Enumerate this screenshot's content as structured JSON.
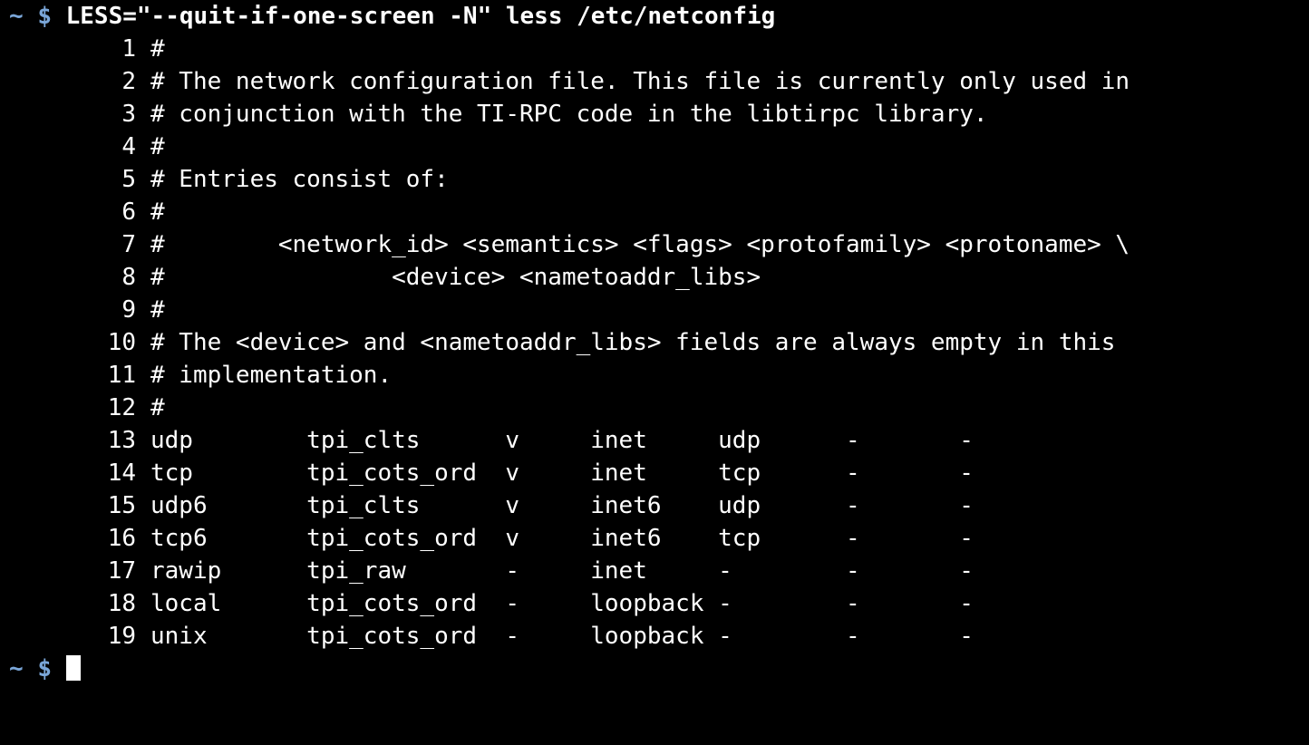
{
  "terminal": {
    "background_color": "#000000",
    "foreground_color": "#ffffff",
    "prompt_color": "#7aa6d8",
    "cursor_color": "#ffffff",
    "prompt_cwd": "~",
    "prompt_symbol": "$",
    "command": "LESS=\"--quit-if-one-screen -N\" less /etc/netconfig",
    "pager_lines": [
      {
        "n": "1",
        "text": "#"
      },
      {
        "n": "2",
        "text": "# The network configuration file. This file is currently only used in"
      },
      {
        "n": "3",
        "text": "# conjunction with the TI-RPC code in the libtirpc library."
      },
      {
        "n": "4",
        "text": "#"
      },
      {
        "n": "5",
        "text": "# Entries consist of:"
      },
      {
        "n": "6",
        "text": "#"
      },
      {
        "n": "7",
        "text": "#        <network_id> <semantics> <flags> <protofamily> <protoname> \\"
      },
      {
        "n": "8",
        "text": "#                <device> <nametoaddr_libs>"
      },
      {
        "n": "9",
        "text": "#"
      },
      {
        "n": "10",
        "text": "# The <device> and <nametoaddr_libs> fields are always empty in this"
      },
      {
        "n": "11",
        "text": "# implementation."
      },
      {
        "n": "12",
        "text": "#"
      },
      {
        "n": "13",
        "text": "udp        tpi_clts      v     inet     udp      -       -"
      },
      {
        "n": "14",
        "text": "tcp        tpi_cots_ord  v     inet     tcp      -       -"
      },
      {
        "n": "15",
        "text": "udp6       tpi_clts      v     inet6    udp      -       -"
      },
      {
        "n": "16",
        "text": "tcp6       tpi_cots_ord  v     inet6    tcp      -       -"
      },
      {
        "n": "17",
        "text": "rawip      tpi_raw       -     inet     -        -       -"
      },
      {
        "n": "18",
        "text": "local      tpi_cots_ord  -     loopback -        -       -"
      },
      {
        "n": "19",
        "text": "unix       tpi_cots_ord  -     loopback -        -       -"
      }
    ],
    "netconfig_table": {
      "columns": [
        "network_id",
        "semantics",
        "flags",
        "protofamily",
        "protoname",
        "device",
        "nametoaddr_libs"
      ],
      "rows": [
        [
          "udp",
          "tpi_clts",
          "v",
          "inet",
          "udp",
          "-",
          "-"
        ],
        [
          "tcp",
          "tpi_cots_ord",
          "v",
          "inet",
          "tcp",
          "-",
          "-"
        ],
        [
          "udp6",
          "tpi_clts",
          "v",
          "inet6",
          "udp",
          "-",
          "-"
        ],
        [
          "tcp6",
          "tpi_cots_ord",
          "v",
          "inet6",
          "tcp",
          "-",
          "-"
        ],
        [
          "rawip",
          "tpi_raw",
          "-",
          "inet",
          "-",
          "-",
          "-"
        ],
        [
          "local",
          "tpi_cots_ord",
          "-",
          "loopback",
          "-",
          "-",
          "-"
        ],
        [
          "unix",
          "tpi_cots_ord",
          "-",
          "loopback",
          "-",
          "-",
          "-"
        ]
      ]
    },
    "final_prompt_cwd": "~",
    "final_prompt_symbol": "$",
    "final_input_value": ""
  }
}
